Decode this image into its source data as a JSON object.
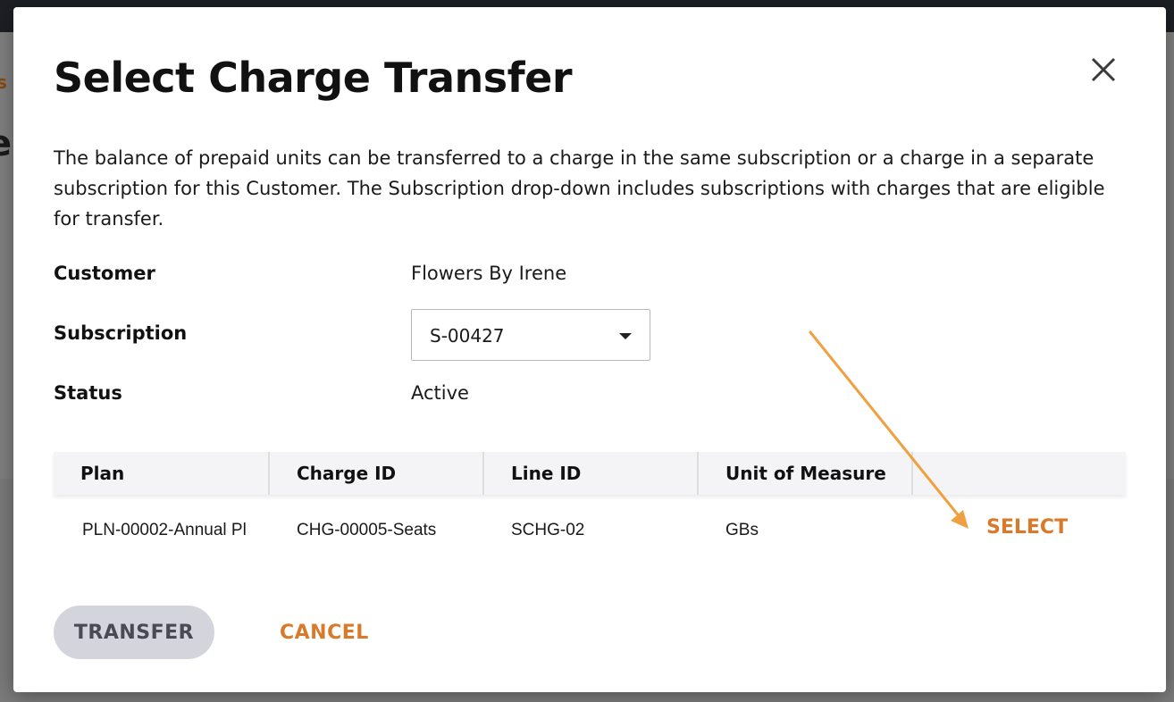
{
  "background": {
    "peek_text_1": "s",
    "peek_text_2": "e"
  },
  "modal": {
    "title": "Select Charge Transfer",
    "close_icon": "close-icon",
    "description": "The balance of prepaid units can be transferred to a charge in the same subscription or a charge in a separate subscription for this Customer. The Subscription drop-down includes subscriptions with charges that are eligible for transfer.",
    "fields": {
      "customer": {
        "label": "Customer",
        "value": "Flowers By Irene"
      },
      "subscription": {
        "label": "Subscription",
        "selected": "S-00427"
      },
      "status": {
        "label": "Status",
        "value": "Active"
      }
    },
    "table": {
      "columns": [
        "Plan",
        "Charge ID",
        "Line ID",
        "Unit of Measure",
        ""
      ],
      "rows": [
        {
          "plan": "PLN-00002-Annual Pl",
          "charge_id": "CHG-00005-Seats",
          "line_id": "SCHG-02",
          "unit": "GBs",
          "action": "SELECT"
        }
      ]
    },
    "buttons": {
      "transfer": "TRANSFER",
      "cancel": "CANCEL"
    }
  },
  "colors": {
    "accent": "#d97a2b",
    "annotation_arrow": "#f0a040",
    "disabled_button_bg": "#d4d4dc"
  }
}
